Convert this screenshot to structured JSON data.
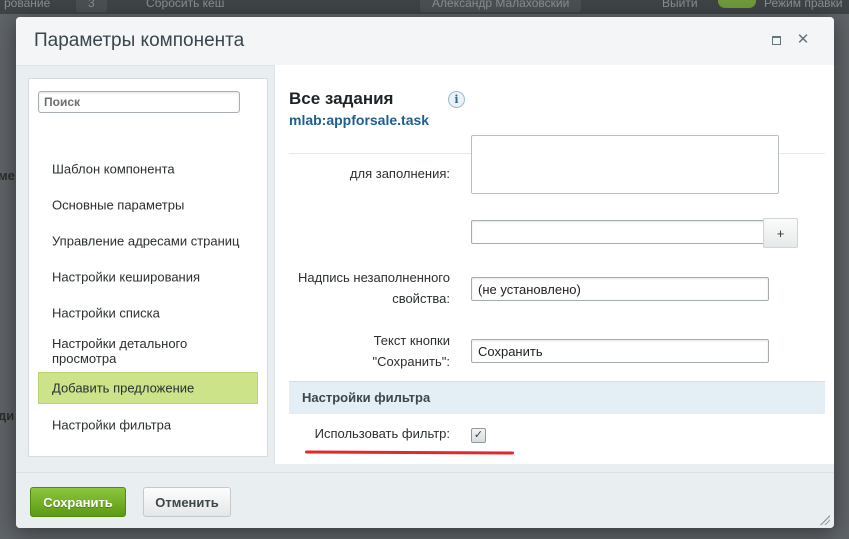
{
  "backdrop": {
    "toolbar_items": [
      "рование",
      "3",
      "Сбросить кеш",
      "Александр Малаховский",
      "Выйти",
      "Режим правки"
    ],
    "side_fragments": [
      "ме",
      "ди"
    ]
  },
  "dialog": {
    "title": "Параметры компонента"
  },
  "sidebar": {
    "search_placeholder": "Поиск",
    "items": [
      {
        "label": "Шаблон компонента"
      },
      {
        "label": "Основные параметры"
      },
      {
        "label": "Управление адресами страниц"
      },
      {
        "label": "Настройки кеширования"
      },
      {
        "label": "Настройки списка"
      },
      {
        "label": "Настройки детального просмотра"
      },
      {
        "label": "Добавить предложение",
        "active": true
      },
      {
        "label": "Настройки фильтра"
      }
    ]
  },
  "panel": {
    "component_name": "Все задания",
    "component_code": "mlab:appforsale.task",
    "info_icon": "i",
    "fields": {
      "required_label": "для заполнения:",
      "add_button": "+",
      "empty_label_line1": "Надпись незаполненного",
      "empty_label_line2": "свойства:",
      "empty_value": "(не установлено)",
      "button_text_line1": "Текст кнопки",
      "button_text_line2": "\"Сохранить\":",
      "button_text_value": "Сохранить"
    },
    "filter_section": {
      "title": "Настройки фильтра",
      "use_filter_label": "Использовать фильтр:",
      "use_filter_checked": true,
      "check_glyph": "✓"
    }
  },
  "footer": {
    "save_label": "Сохранить",
    "cancel_label": "Отменить"
  }
}
